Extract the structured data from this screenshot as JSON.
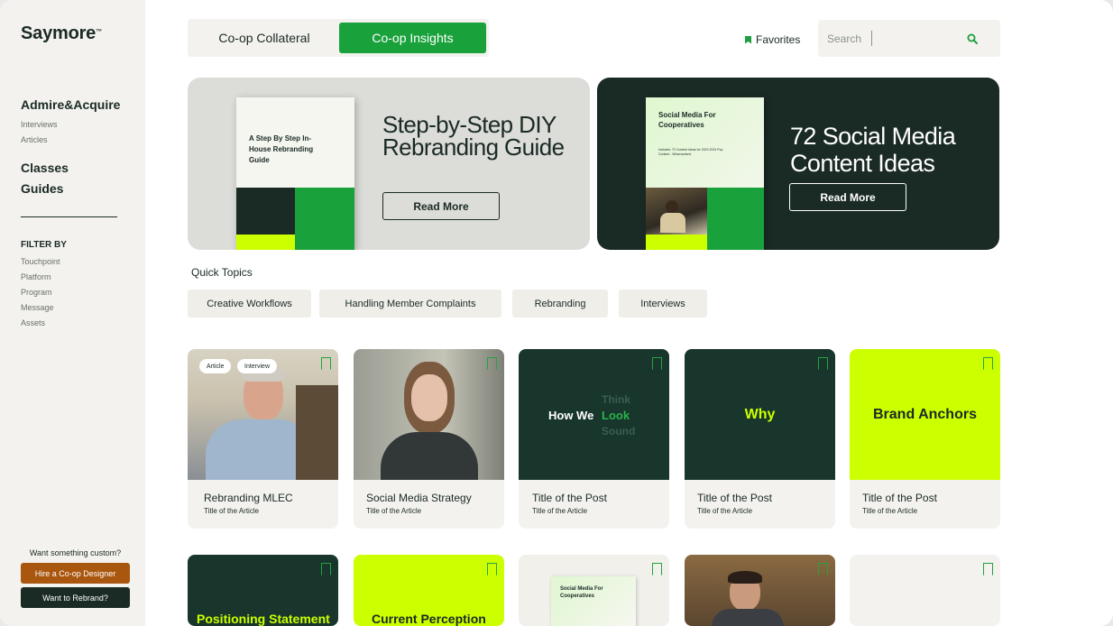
{
  "sidebar": {
    "logo": "Saymore",
    "logo_tm": "™",
    "brand_heading": "Admire&Acquire",
    "brand_links": [
      "Interviews",
      "Articles"
    ],
    "headings": [
      "Classes",
      "Guides"
    ],
    "filter_heading": "FILTER BY",
    "filters": [
      "Touchpoint",
      "Platform",
      "Program",
      "Message",
      "Assets"
    ],
    "custom_prompt": "Want something custom?",
    "hire_button": "Hire a Co-op Designer",
    "rebrand_button": "Want to Rebrand?"
  },
  "topbar": {
    "tabs": [
      {
        "label": "Co-op Collateral",
        "active": false
      },
      {
        "label": "Co-op Insights",
        "active": true
      }
    ],
    "favorites_label": "Favorites",
    "search_placeholder": "Search",
    "search_icon": "search-icon"
  },
  "heroes": [
    {
      "book_title": "A Step By Step In-House Rebranding Guide",
      "title": "Step-by-Step DIY Rebranding Guide",
      "button": "Read More"
    },
    {
      "book_title": "Social Media For Cooperatives",
      "book_sub": "Includes: 72 Content Ideas for 2023 2024 Pop Content - What worked.",
      "title": "72 Social Media Content Ideas",
      "button": "Read More"
    }
  ],
  "quick_topics": {
    "label": "Quick Topics",
    "chips": [
      "Creative Workflows",
      "Handling Member Complaints",
      "Rebranding",
      "Interviews"
    ]
  },
  "cards_row1": [
    {
      "title": "Rebranding MLEC",
      "subtitle": "Title of the Article",
      "tags": [
        "Article",
        "Interview"
      ]
    },
    {
      "title": "Social Media Strategy",
      "subtitle": "Title of the Article"
    },
    {
      "title": "Title of the Post",
      "subtitle": "Title of the Article",
      "image_text": "How We",
      "image_words": [
        "Think",
        "Look",
        "Sound"
      ]
    },
    {
      "title": "Title of the Post",
      "subtitle": "Title of the Article",
      "image_text": "Why"
    },
    {
      "title": "Title of the Post",
      "subtitle": "Title of the Article",
      "image_text": "Brand Anchors"
    }
  ],
  "cards_row2": [
    {
      "image_text": "Positioning Statement"
    },
    {
      "image_text": "Current Perception"
    },
    {
      "image_text": "Social Media For Cooperatives"
    },
    {
      "image_text": ""
    },
    {
      "image_text": ""
    }
  ],
  "colors": {
    "brand_dark": "#1a2a25",
    "brand_green": "#19a13c",
    "brand_lime": "#ccff00",
    "hire_orange": "#a9560e"
  }
}
